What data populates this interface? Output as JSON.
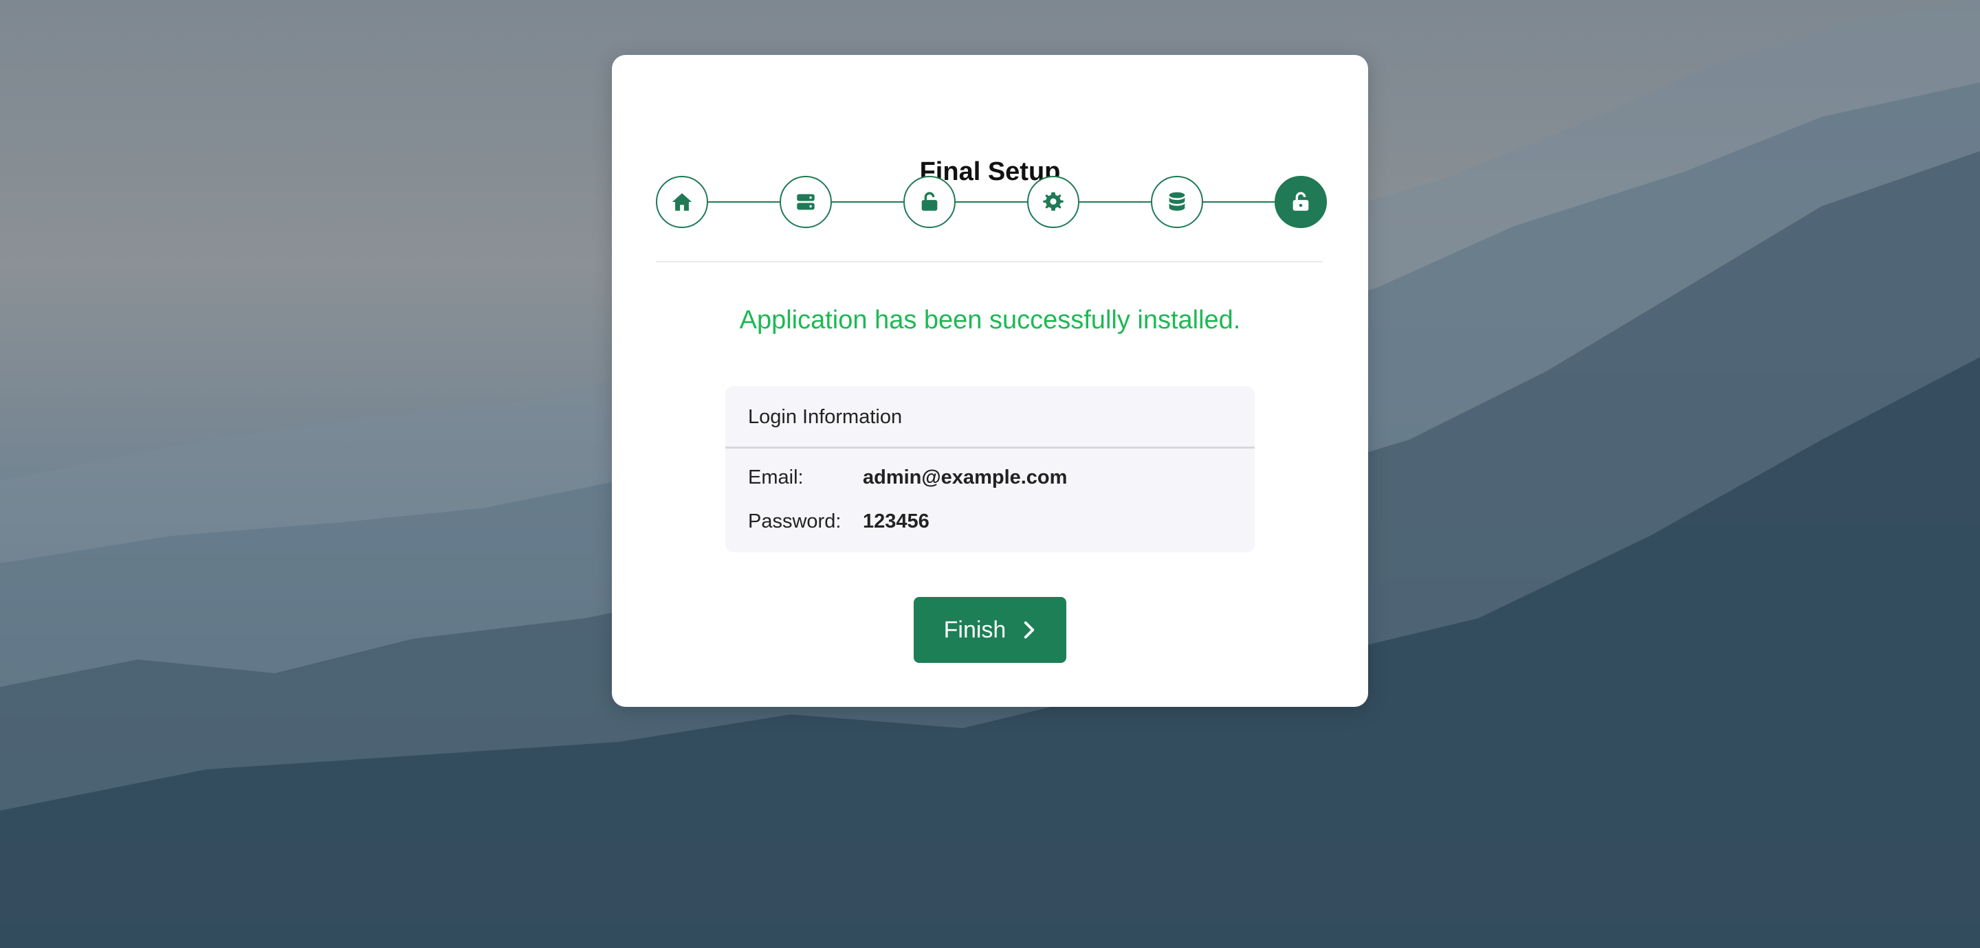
{
  "card": {
    "title": "Final Setup"
  },
  "stepper": {
    "steps": [
      {
        "icon": "home-icon",
        "active": false
      },
      {
        "icon": "server-icon",
        "active": false
      },
      {
        "icon": "unlock-icon",
        "active": false
      },
      {
        "icon": "gear-icon",
        "active": false
      },
      {
        "icon": "database-icon",
        "active": false
      },
      {
        "icon": "unlock-icon",
        "active": true
      }
    ]
  },
  "main": {
    "success_message": "Application has been successfully installed.",
    "login": {
      "header": "Login Information",
      "email_label": "Email:",
      "email_value": "admin@example.com",
      "password_label": "Password:",
      "password_value": "123456"
    },
    "finish_label": "Finish"
  },
  "colors": {
    "accent": "#1f7a55",
    "success": "#1db954"
  }
}
